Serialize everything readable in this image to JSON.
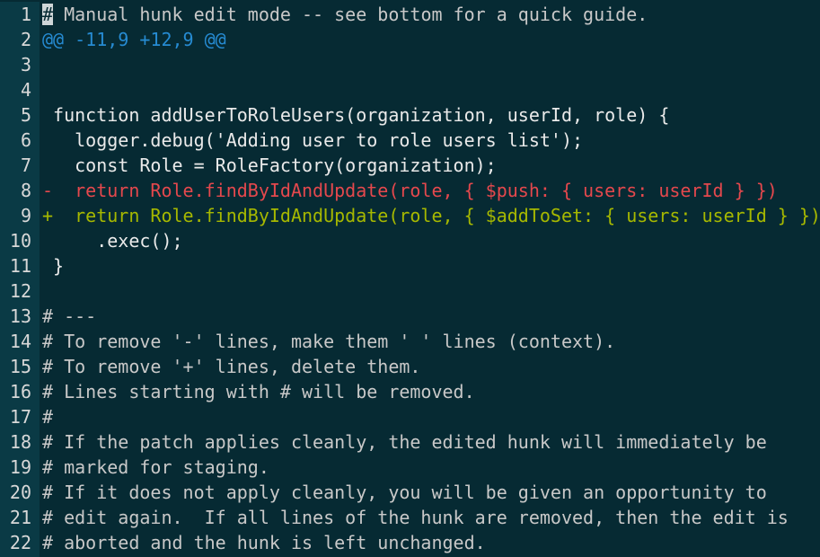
{
  "colors": {
    "background": "#062a33",
    "gutter": "#0a3a45",
    "hunk_header": "#268bd2",
    "removed": "#e5484d",
    "added": "#a6b800",
    "comment": "#c8c8c8",
    "text": "#eaeaea"
  },
  "editor": {
    "lines": [
      {
        "n": "1",
        "kind": "comment",
        "cursor_char": "#",
        "text": " Manual hunk edit mode -- see bottom for a quick guide."
      },
      {
        "n": "2",
        "kind": "hunk",
        "text": "@@ -11,9 +12,9 @@"
      },
      {
        "n": "3",
        "kind": "code",
        "text": ""
      },
      {
        "n": "4",
        "kind": "code",
        "text": ""
      },
      {
        "n": "5",
        "kind": "code",
        "text": " function addUserToRoleUsers(organization, userId, role) {"
      },
      {
        "n": "6",
        "kind": "code",
        "text": "   logger.debug('Adding user to role users list');"
      },
      {
        "n": "7",
        "kind": "code",
        "text": "   const Role = RoleFactory(organization);"
      },
      {
        "n": "8",
        "kind": "removed",
        "text": "-  return Role.findByIdAndUpdate(role, { $push: { users: userId } })"
      },
      {
        "n": "9",
        "kind": "added",
        "text": "+  return Role.findByIdAndUpdate(role, { $addToSet: { users: userId } })"
      },
      {
        "n": "10",
        "kind": "code",
        "text": "     .exec();"
      },
      {
        "n": "11",
        "kind": "code",
        "text": " }"
      },
      {
        "n": "12",
        "kind": "code",
        "text": ""
      },
      {
        "n": "13",
        "kind": "comment",
        "text": "# ---"
      },
      {
        "n": "14",
        "kind": "comment",
        "text": "# To remove '-' lines, make them ' ' lines (context)."
      },
      {
        "n": "15",
        "kind": "comment",
        "text": "# To remove '+' lines, delete them."
      },
      {
        "n": "16",
        "kind": "comment",
        "text": "# Lines starting with # will be removed."
      },
      {
        "n": "17",
        "kind": "comment",
        "text": "#"
      },
      {
        "n": "18",
        "kind": "comment",
        "text": "# If the patch applies cleanly, the edited hunk will immediately be"
      },
      {
        "n": "19",
        "kind": "comment",
        "text": "# marked for staging."
      },
      {
        "n": "20",
        "kind": "comment",
        "text": "# If it does not apply cleanly, you will be given an opportunity to"
      },
      {
        "n": "21",
        "kind": "comment",
        "text": "# edit again.  If all lines of the hunk are removed, then the edit is"
      },
      {
        "n": "22",
        "kind": "comment",
        "text": "# aborted and the hunk is left unchanged."
      }
    ]
  }
}
